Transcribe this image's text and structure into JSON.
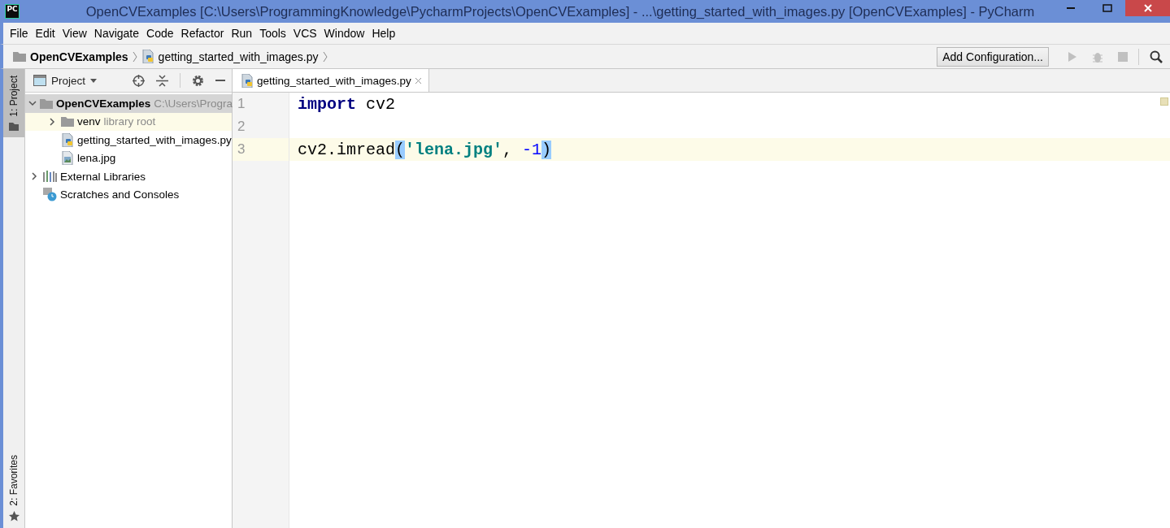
{
  "window": {
    "app_badge": "PC",
    "title": "OpenCVExamples [C:\\Users\\ProgrammingKnowledge\\PycharmProjects\\OpenCVExamples] - ...\\getting_started_with_images.py [OpenCVExamples] - PyCharm"
  },
  "menu": [
    "File",
    "Edit",
    "View",
    "Navigate",
    "Code",
    "Refactor",
    "Run",
    "Tools",
    "VCS",
    "Window",
    "Help"
  ],
  "breadcrumbs": [
    {
      "kind": "folder",
      "label": "OpenCVExamples"
    },
    {
      "kind": "python",
      "label": "getting_started_with_images.py"
    }
  ],
  "toolbar": {
    "configuration_button": "Add Configuration...",
    "run_disabled": true
  },
  "side_tabs": [
    {
      "label": "1: Project",
      "selected": true,
      "kind": "folder"
    },
    {
      "label": "2: Favorites",
      "selected": false,
      "kind": "star"
    }
  ],
  "project_panel": {
    "title": "Project",
    "tree": [
      {
        "kind": "folder",
        "label": "OpenCVExamples",
        "hint": "C:\\Users\\Progra",
        "expanded": true,
        "selected": true,
        "children": [
          {
            "kind": "folder",
            "label": "venv",
            "hint": "library root",
            "expanded": false,
            "selected": false
          },
          {
            "kind": "python",
            "label": "getting_started_with_images.py",
            "selected": false
          },
          {
            "kind": "image",
            "label": "lena.jpg",
            "selected": false
          }
        ]
      },
      {
        "kind": "libraries",
        "label": "External Libraries",
        "expanded": false,
        "selected": false
      },
      {
        "kind": "scratches",
        "label": "Scratches and Consoles",
        "selected": false
      }
    ]
  },
  "editor": {
    "tabs": [
      {
        "label": "getting_started_with_images.py",
        "selected": true
      }
    ],
    "lines": [
      {
        "number": "1",
        "current": false,
        "tokens": [
          {
            "kind": "keyword",
            "text": "import"
          },
          {
            "kind": "plain",
            "text": " cv2"
          }
        ]
      },
      {
        "number": "2",
        "current": false
      },
      {
        "number": "3",
        "current": true,
        "tokens": [
          {
            "kind": "plain",
            "text": "cv2.imread"
          },
          {
            "kind": "brace",
            "text": "("
          },
          {
            "kind": "string",
            "text": "'lena.jpg'"
          },
          {
            "kind": "plain",
            "text": ", "
          },
          {
            "kind": "number",
            "text": "-1"
          },
          {
            "kind": "brace",
            "text": ")"
          }
        ]
      }
    ]
  }
}
